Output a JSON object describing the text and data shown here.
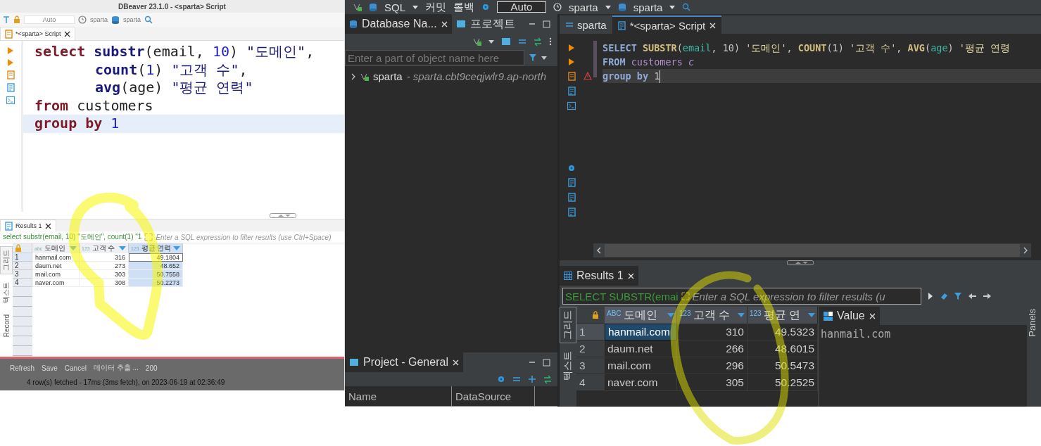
{
  "left_window": {
    "title": "DBeaver 23.1.0 - <sparta> Script",
    "toolbar": {
      "mode": "Auto",
      "datasource": "sparta",
      "schema": "sparta"
    },
    "editor_tabs": [
      {
        "label": "*<sparta> Script",
        "selected": true
      }
    ],
    "code": [
      {
        "current": false,
        "indented": false,
        "tokens": [
          {
            "text": "select",
            "kind": "keyword"
          },
          {
            "text": " substr",
            "kind": "function"
          },
          {
            "text": "(email, ",
            "kind": "plain"
          },
          {
            "text": "10",
            "kind": "number"
          },
          {
            "text": ") ",
            "kind": "plain"
          },
          {
            "text": "\"도메인\"",
            "kind": "string"
          },
          {
            "text": ",",
            "kind": "plain"
          }
        ]
      },
      {
        "current": false,
        "indented": true,
        "tokens": [
          {
            "text": "count",
            "kind": "function"
          },
          {
            "text": "(",
            "kind": "plain"
          },
          {
            "text": "1",
            "kind": "number"
          },
          {
            "text": ") ",
            "kind": "plain"
          },
          {
            "text": "\"고객 수\"",
            "kind": "string"
          },
          {
            "text": ",",
            "kind": "plain"
          }
        ]
      },
      {
        "current": false,
        "indented": true,
        "tokens": [
          {
            "text": "avg",
            "kind": "function"
          },
          {
            "text": "(age) ",
            "kind": "plain"
          },
          {
            "text": "\"평균 연력\"",
            "kind": "string"
          }
        ]
      },
      {
        "current": false,
        "indented": false,
        "tokens": [
          {
            "text": "from",
            "kind": "keyword"
          },
          {
            "text": " customers",
            "kind": "plain"
          }
        ]
      },
      {
        "current": true,
        "indented": false,
        "tokens": [
          {
            "text": "group by",
            "kind": "keyword"
          },
          {
            "text": " 1",
            "kind": "number"
          }
        ]
      }
    ],
    "results": {
      "tab": "Results 1",
      "query": "select substr(email, 10) \"도메인\", count(1) \"1",
      "filter_placeholder": "Enter a SQL expression to filter results (use Ctrl+Space)",
      "view_tabs": [
        {
          "label": "그리드",
          "selected": true
        },
        {
          "label": "텍스트",
          "selected": false
        },
        {
          "label": "Record",
          "selected": false
        }
      ],
      "columns": [
        {
          "type_label": "abc",
          "name": "도메인",
          "kind": "text",
          "selected": false
        },
        {
          "type_label": "123",
          "name": "고객 수",
          "kind": "number",
          "selected": false
        },
        {
          "type_label": "123",
          "name": "평균 연력",
          "kind": "number",
          "selected": true
        }
      ],
      "rows": [
        {
          "number": "1",
          "cells": [
            "hanmail.com",
            "316",
            "49.1804"
          ],
          "selected": true
        },
        {
          "number": "2",
          "cells": [
            "daum.net",
            "273",
            "48.652"
          ],
          "selected": false
        },
        {
          "number": "3",
          "cells": [
            "mail.com",
            "303",
            "50.7558"
          ],
          "selected": false
        },
        {
          "number": "4",
          "cells": [
            "naver.com",
            "308",
            "50.2273"
          ],
          "selected": false
        }
      ],
      "actions": [
        "Refresh",
        "Save",
        "Cancel",
        "데이터 추출 ...",
        "200"
      ],
      "status": "4 row(s) fetched - 17ms (3ms fetch), on 2023-06-19 at 02:36:49"
    }
  },
  "right_window": {
    "toolbar": {
      "sql": "SQL",
      "commit": "커밋",
      "rollback": "롤백",
      "mode": "Auto",
      "datasource": "sparta",
      "schema": "sparta"
    },
    "navigator": {
      "tabs": [
        {
          "label": "Database Na...",
          "selected": true
        },
        {
          "label": "프로젝트",
          "selected": false
        }
      ],
      "filter_placeholder": "Enter a part of object name here",
      "tree": [
        {
          "label": "sparta",
          "detail": "- sparta.cbt9ceqjwlr9.ap-north",
          "expanded": false
        }
      ]
    },
    "project": {
      "tab": "Project - General",
      "columns": [
        "Name",
        "DataSource"
      ]
    },
    "editor_tabs": [
      {
        "label": "sparta",
        "selected": false
      },
      {
        "label": "*<sparta> Script",
        "selected": true
      }
    ],
    "code": [
      {
        "current": false,
        "tokens": [
          {
            "text": "SELECT",
            "kind": "keyword"
          },
          {
            "text": " SUBSTR",
            "kind": "function"
          },
          {
            "text": "(",
            "kind": "plain"
          },
          {
            "text": "email",
            "kind": "column"
          },
          {
            "text": ", 10) ",
            "kind": "plain"
          },
          {
            "text": "'도메인'",
            "kind": "string"
          },
          {
            "text": ", ",
            "kind": "plain"
          },
          {
            "text": "COUNT",
            "kind": "function"
          },
          {
            "text": "(1) ",
            "kind": "plain"
          },
          {
            "text": "'고객 수'",
            "kind": "string"
          },
          {
            "text": ", ",
            "kind": "plain"
          },
          {
            "text": "AVG",
            "kind": "function"
          },
          {
            "text": "(",
            "kind": "plain"
          },
          {
            "text": "age",
            "kind": "column"
          },
          {
            "text": ") ",
            "kind": "plain"
          },
          {
            "text": "'평균 연령",
            "kind": "string"
          }
        ]
      },
      {
        "current": false,
        "tokens": [
          {
            "text": "FROM",
            "kind": "keyword"
          },
          {
            "text": " customers",
            "kind": "table"
          },
          {
            "text": " c",
            "kind": "alias"
          }
        ]
      },
      {
        "current": true,
        "tokens": [
          {
            "text": "group by",
            "kind": "keyword"
          },
          {
            "text": " 1",
            "kind": "plain"
          }
        ]
      }
    ],
    "results": {
      "tab": "Results 1",
      "query": "SELECT SUBSTR(emai",
      "filter_placeholder": "Enter a SQL expression to filter results (u",
      "view_tabs": [
        {
          "label": "그리드",
          "selected": true
        },
        {
          "label": "텍스트",
          "selected": false
        }
      ],
      "columns": [
        {
          "type_label": "ABC",
          "name": "도메인",
          "kind": "text",
          "selected": true
        },
        {
          "type_label": "123",
          "name": "고객 수",
          "kind": "number",
          "selected": false
        },
        {
          "type_label": "123",
          "name": "평균 연",
          "kind": "number",
          "selected": false
        }
      ],
      "rows": [
        {
          "number": "1",
          "cells": [
            "hanmail.com",
            "310",
            "49.5323"
          ],
          "selected": true
        },
        {
          "number": "2",
          "cells": [
            "daum.net",
            "266",
            "48.6015"
          ],
          "selected": false
        },
        {
          "number": "3",
          "cells": [
            "mail.com",
            "296",
            "50.5473"
          ],
          "selected": false
        },
        {
          "number": "4",
          "cells": [
            "naver.com",
            "305",
            "50.2525"
          ],
          "selected": false
        }
      ],
      "value_panel": {
        "title": "Value",
        "content": "hanmail.com"
      },
      "side_panel": "Panels"
    }
  }
}
